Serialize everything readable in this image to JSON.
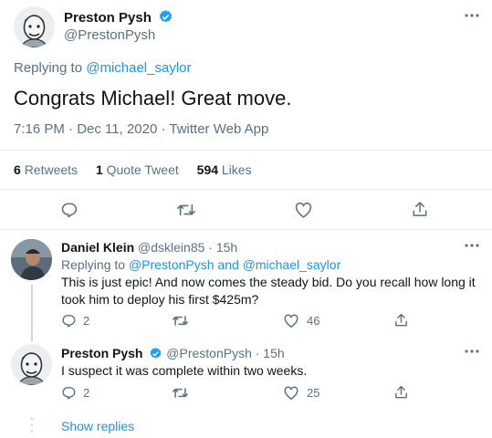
{
  "main_tweet": {
    "author_name": "Preston Pysh",
    "author_handle": "@PrestonPysh",
    "replying_prefix": "Replying to ",
    "replying_to": "@michael_saylor",
    "text": "Congrats Michael!  Great move.",
    "meta": "7:16 PM · Dec 11, 2020 · Twitter Web App",
    "stats": {
      "retweets_count": "6",
      "retweets_label": "Retweets",
      "quotes_count": "1",
      "quotes_label": "Quote Tweet",
      "likes_count": "594",
      "likes_label": "Likes"
    }
  },
  "replies": [
    {
      "author_name": "Daniel Klein",
      "author_handle": "@dsklein85",
      "time": "· 15h",
      "replying_prefix": "Replying to ",
      "replying_to": "@PrestonPysh and @michael_saylor",
      "text_line1": "This is just epic! And now comes the steady bid. Do you recall how long it",
      "text_line2": "took him to deploy his first $425m?",
      "reply_count": "2",
      "like_count": "46"
    },
    {
      "author_name": "Preston Pysh",
      "author_handle": "@PrestonPysh",
      "time": "· 15h",
      "text": "I suspect it was complete within two weeks.",
      "reply_count": "2",
      "like_count": "25"
    }
  ],
  "show_replies": "Show replies",
  "colors": {
    "accent": "#1b95e0",
    "secondary_text": "#5b7083",
    "divider": "#e6ecf0"
  }
}
